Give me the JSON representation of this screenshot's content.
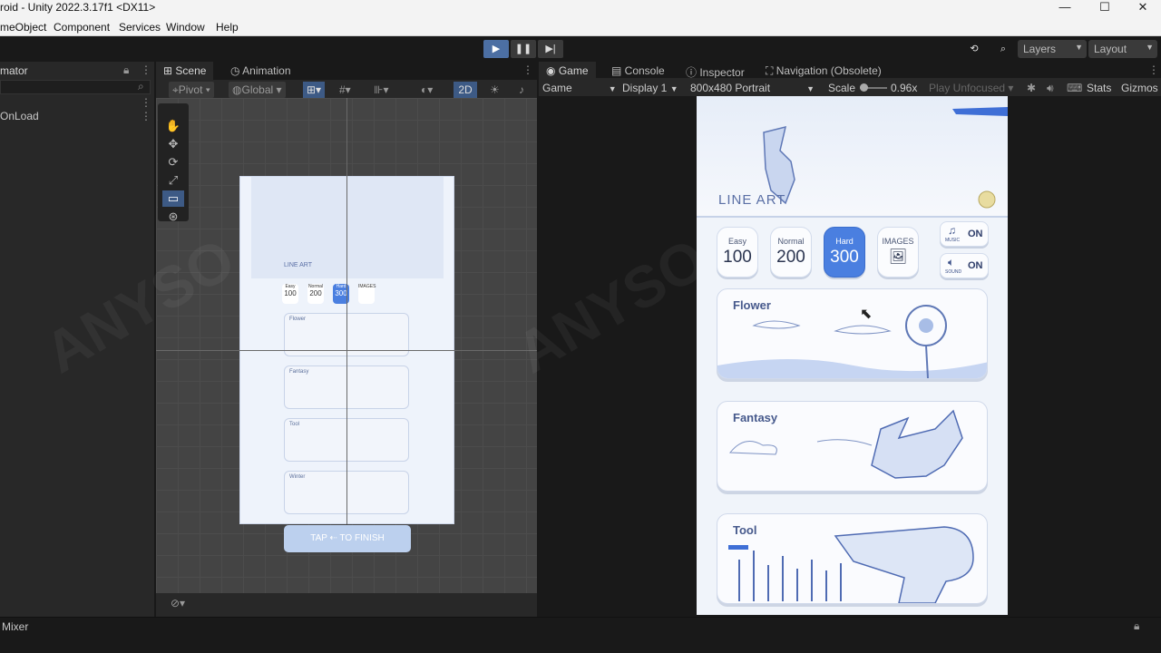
{
  "window": {
    "title": "roid - Unity 2022.3.17f1 <DX11>"
  },
  "menu": [
    "meObject",
    "Component",
    "Services",
    "Window",
    "Help"
  ],
  "toolbar": {
    "layers": "Layers",
    "layout": "Layout"
  },
  "hierarchy": {
    "tab": "mator",
    "item": "OnLoad"
  },
  "scene": {
    "tabs": [
      "Scene",
      "Animation"
    ],
    "pivot": "Pivot",
    "global": "Global",
    "mode_2d": "2D",
    "mini": {
      "labels": [
        "Easy",
        "Normal",
        "Hard",
        "IMAGES"
      ],
      "values": [
        "100",
        "200",
        "300"
      ],
      "cards": [
        "Flower",
        "Fantasy",
        "Tool",
        "Winter"
      ],
      "logo": "LINE ART",
      "finish": "TAP ⇠ TO FINISH"
    }
  },
  "game": {
    "tabs": [
      "Game",
      "Console",
      "Inspector",
      "Navigation (Obsolete)"
    ],
    "mode": "Game",
    "display": "Display 1",
    "resolution": "800x480 Portrait",
    "scale_label": "Scale",
    "scale_value": "0.96x",
    "play_unfocused": "Play Unfocused",
    "stats": "Stats",
    "gizmos": "Gizmos",
    "logo": "LINE ART",
    "difficulties": [
      {
        "label": "Easy",
        "value": "100"
      },
      {
        "label": "Normal",
        "value": "200"
      },
      {
        "label": "Hard",
        "value": "300"
      }
    ],
    "images_label": "IMAGES",
    "music": {
      "small": "MUSIC",
      "value": "ON"
    },
    "sound": {
      "small": "SOUND",
      "value": "ON"
    },
    "categories": [
      "Flower",
      "Fantasy",
      "Tool"
    ]
  },
  "bottom": {
    "mixer": "Mixer"
  },
  "colors": {
    "accent": "#4c6fa3",
    "hard_selected": "#4a7fe0",
    "card_text": "#46598c"
  }
}
